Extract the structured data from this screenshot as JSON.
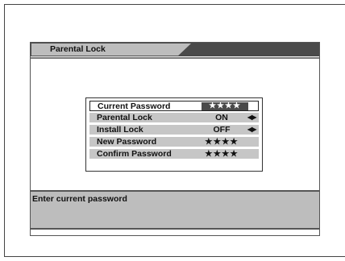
{
  "header": {
    "title": "Parental Lock"
  },
  "menu": {
    "items": [
      {
        "label": "Current Password",
        "value": "★★★★",
        "selected": true,
        "has_arrows": false
      },
      {
        "label": "Parental Lock",
        "value": "ON",
        "selected": false,
        "has_arrows": true
      },
      {
        "label": "Install Lock",
        "value": "OFF",
        "selected": false,
        "has_arrows": true
      },
      {
        "label": "New Password",
        "value": "★★★★",
        "selected": false,
        "has_arrows": false
      },
      {
        "label": "Confirm Password",
        "value": "★★★★",
        "selected": false,
        "has_arrows": false
      }
    ],
    "arrow_glyph": "◀▶"
  },
  "status": {
    "message": "Enter current password"
  },
  "colors": {
    "header_dark": "#4a4a4a",
    "header_tab": "#bdbdbd",
    "row_bg": "#c6c6c6",
    "status_bg": "#bdbdbd"
  }
}
